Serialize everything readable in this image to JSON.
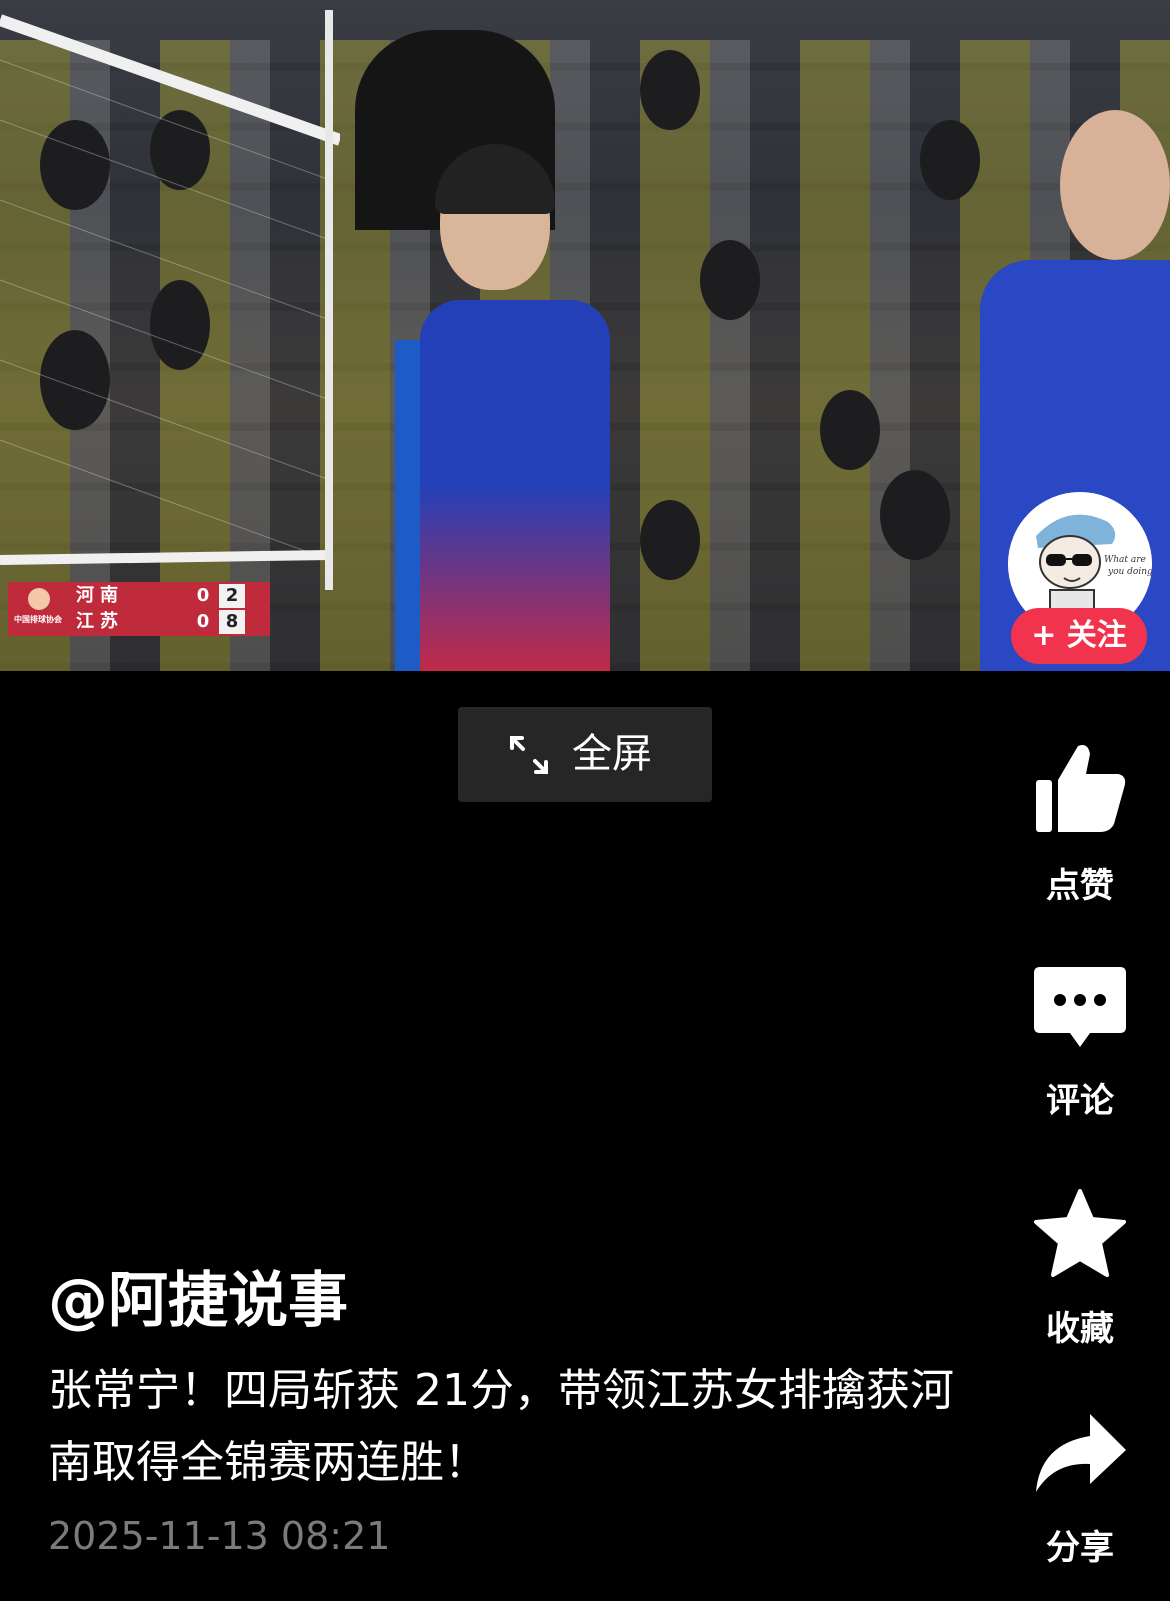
{
  "video": {
    "scoreboard": {
      "org": "中国排球协会",
      "teams": [
        {
          "name": "河南",
          "sets": "0",
          "points": "2"
        },
        {
          "name": "江苏",
          "sets": "0",
          "points": "8"
        }
      ]
    },
    "follow_label": "+ 关注"
  },
  "fullscreen": {
    "label": "全屏"
  },
  "actions": {
    "like": "点赞",
    "comment": "评论",
    "favorite": "收藏",
    "share": "分享"
  },
  "post": {
    "author": "@阿捷说事",
    "description": "张常宁！四局斩获 21分，带领江苏女排擒获河南取得全锦赛两连胜！",
    "timestamp": "2025-11-13 08:21"
  },
  "colors": {
    "follow": "#f2334d",
    "scoreboard": "#c02b3b",
    "background": "#000000",
    "timestamp": "#7b7b7b"
  }
}
